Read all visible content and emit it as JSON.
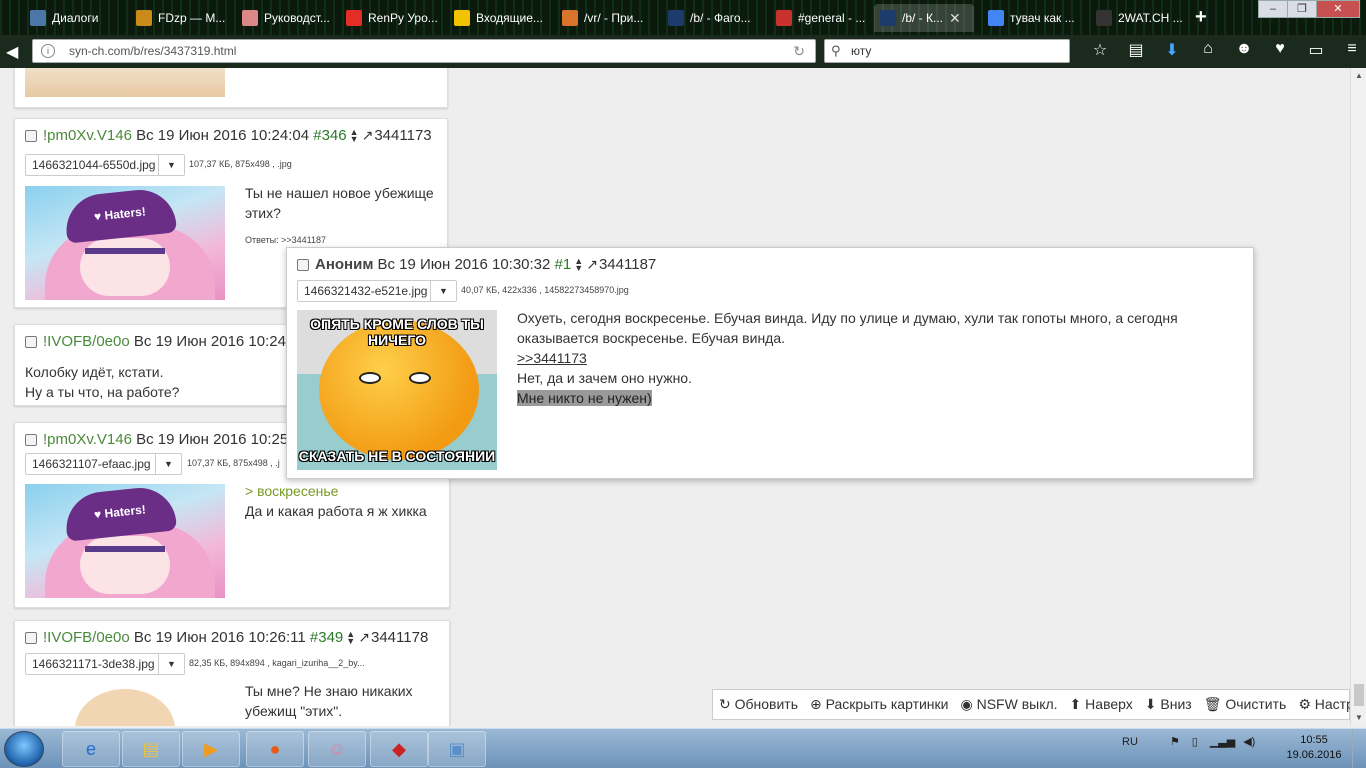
{
  "browser": {
    "tabs": [
      {
        "label": "Диалоги",
        "icon": "vk-icon",
        "color": "#4a76a8"
      },
      {
        "label": "FDzp — М...",
        "icon": "smiley-icon",
        "color": "#c98a1a"
      },
      {
        "label": "Руководст...",
        "icon": "anime-avatar-icon",
        "color": "#d88"
      },
      {
        "label": "RenPy Уро...",
        "icon": "youtube-icon",
        "color": "#e52d27"
      },
      {
        "label": "Входящие...",
        "icon": "gmail-icon",
        "color": "#f2c200"
      },
      {
        "label": "/vr/ - При...",
        "icon": "lightning-icon",
        "color": "#d9742a"
      },
      {
        "label": "/b/ - Фаго...",
        "icon": "board-icon",
        "color": "#1d3b6b"
      },
      {
        "label": "#general - ...",
        "icon": "chat-icon",
        "color": "#c8312e"
      },
      {
        "label": "/b/ - К...",
        "icon": "board-icon",
        "color": "#1d3b6b"
      },
      {
        "label": "тувач как ...",
        "icon": "google-icon",
        "color": "#4285f4"
      },
      {
        "label": "2WAT.CH ...",
        "icon": "warning-icon",
        "color": "#333"
      }
    ],
    "url": "syn-ch.com/b/res/3437319.html",
    "search": "юту"
  },
  "posts": [
    {
      "trip": "!pm0Xv.V146",
      "date": "Вс 19 Июн 2016 10:24:04",
      "num": "#346",
      "ref": "3441173",
      "file": "1466321044-6550d.jpg",
      "finfo": "107,37 КБ, 875x498 , .jpg",
      "text": [
        "Ты не нашел новое убежище",
        "этих?"
      ],
      "replies": "Ответы: >>3441187"
    },
    {
      "trip": "!IVOFB/0e0o",
      "date": "Вс 19 Июн 2016 10:24",
      "text": [
        "Колобку идёт, кстати.",
        "Ну а ты что, на работе?"
      ]
    },
    {
      "trip": "!pm0Xv.V146",
      "date": "Вс 19 Июн 2016 10:25",
      "file": "1466321107-efaac.jpg",
      "finfo": "107,37 КБ, 875x498 , .j",
      "quote": "> воскресенье",
      "text": [
        "Да и какая работа я ж хикка"
      ]
    },
    {
      "trip": "!IVOFB/0e0o",
      "date": "Вс 19 Июн 2016 10:26:11",
      "num": "#349",
      "ref": "3441178",
      "file": "1466321171-3de38.jpg",
      "finfo": "82,35 КБ, 894x894 , kagari_izuriha__2_by...",
      "text": [
        "Ты мне? Не знаю никаких",
        "убежищ \"этих\"."
      ]
    }
  ],
  "popup": {
    "name": "Аноним",
    "date": "Вс 19 Июн 2016 10:30:32",
    "num": "#1",
    "ref": "3441187",
    "file": "1466321432-e521e.jpg",
    "finfo": "40,07 КБ, 422x336 , 14582273458970.jpg",
    "meme_top": "ОПЯТЬ КРОМЕ СЛОВ ТЫ НИЧЕГО",
    "meme_bottom": "СКАЗАТЬ НЕ В СОСТОЯНИИ",
    "line1": "Охуеть, сегодня воскресенье. Ебучая винда. Иду по улице и думаю, хули так гопоты много, а сегодня",
    "line2": "оказывается воскресенье. Ебучая винда.",
    "link": ">>3441173",
    "line3": "Нет, да и зачем оно нужно.",
    "line4": "Мне никто не нужен)"
  },
  "toolbar": {
    "refresh": "Обновить",
    "expand": "Раскрыть картинки",
    "nsfw": "NSFW выкл.",
    "up": "Наверх",
    "down": "Вниз",
    "clear": "Очистить",
    "settings": "Настройки"
  },
  "taskbar": {
    "lang": "RU",
    "time": "10:55",
    "date": "19.06.2016"
  }
}
